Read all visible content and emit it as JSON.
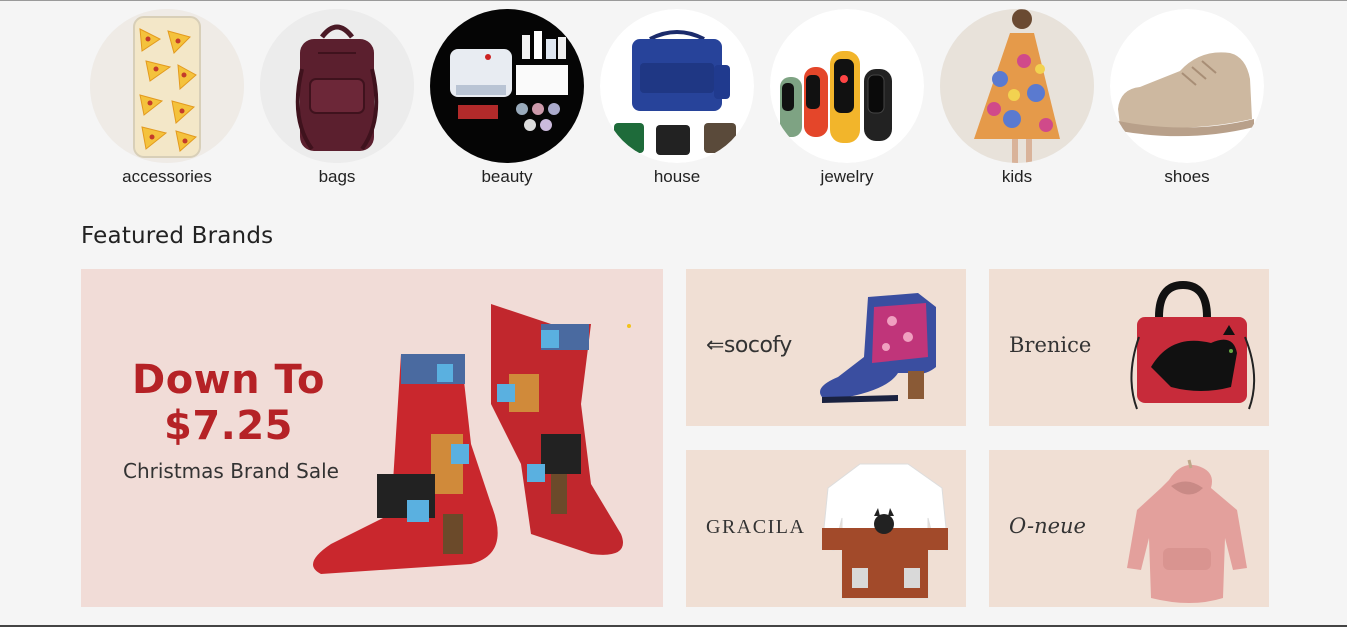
{
  "categories": [
    {
      "label": "accessories",
      "icon": "phone-case-image"
    },
    {
      "label": "bags",
      "icon": "backpack-image"
    },
    {
      "label": "beauty",
      "icon": "nail-kit-image"
    },
    {
      "label": "house",
      "icon": "cooler-bag-image"
    },
    {
      "label": "jewelry",
      "icon": "smart-band-image"
    },
    {
      "label": "kids",
      "icon": "girl-dress-image"
    },
    {
      "label": "shoes",
      "icon": "sneaker-image"
    }
  ],
  "featured": {
    "title": "Featured Brands",
    "banner": {
      "headline_line1": "Down To",
      "headline_line2": "$7.25",
      "subtitle": "Christmas Brand Sale"
    },
    "brands": [
      {
        "name": "socofy",
        "logo_text": "⇐socofy"
      },
      {
        "name": "Brenice",
        "logo_text": "Brenice"
      },
      {
        "name": "GRACILA",
        "logo_text": "GRACILA"
      },
      {
        "name": "O-neue",
        "logo_text": "O-neue"
      }
    ]
  },
  "colors": {
    "page_bg": "#f5f5f5",
    "banner_bg": "#f1dcd7",
    "tile_bg": "#f0dfd4",
    "headline_red": "#b52226"
  }
}
